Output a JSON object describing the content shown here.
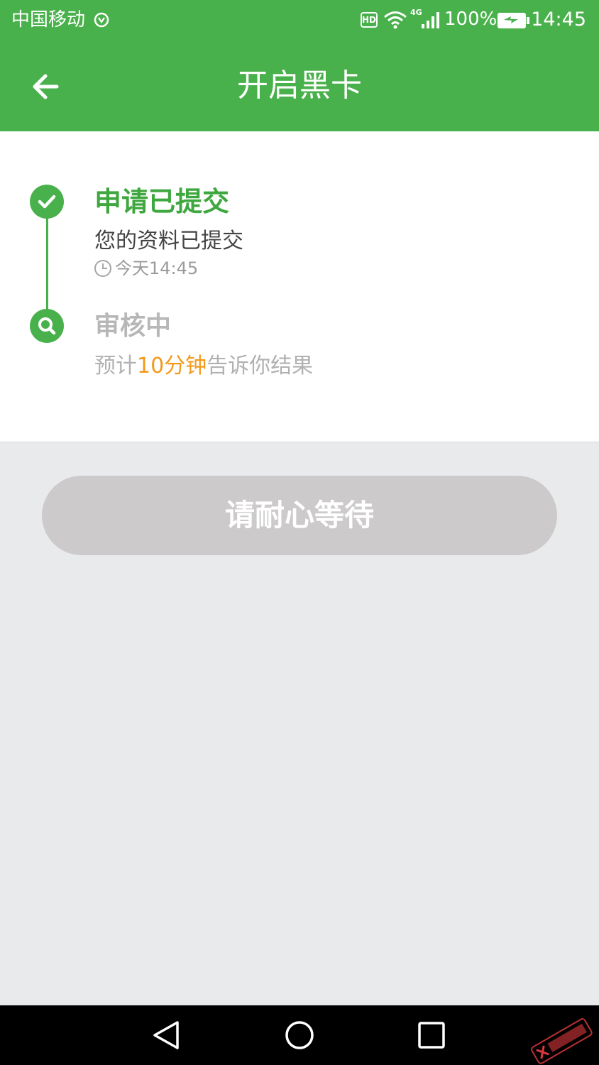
{
  "status_bar": {
    "carrier": "中国移动",
    "hd": "HD",
    "network": "4G",
    "battery": "100%",
    "time": "14:45"
  },
  "app_bar": {
    "title": "开启黑卡"
  },
  "timeline": {
    "step1": {
      "title": "申请已提交",
      "desc": "您的资料已提交",
      "time": "今天14:45"
    },
    "step2": {
      "title": "审核中",
      "desc_prefix": "预计",
      "desc_highlight": "10分钟",
      "desc_suffix": "告诉你结果"
    }
  },
  "actions": {
    "wait_label": "请耐心等待"
  },
  "colors": {
    "brand_green": "#49b14b",
    "highlight_orange": "#f39a1d",
    "disabled_button": "#cdcacb"
  }
}
